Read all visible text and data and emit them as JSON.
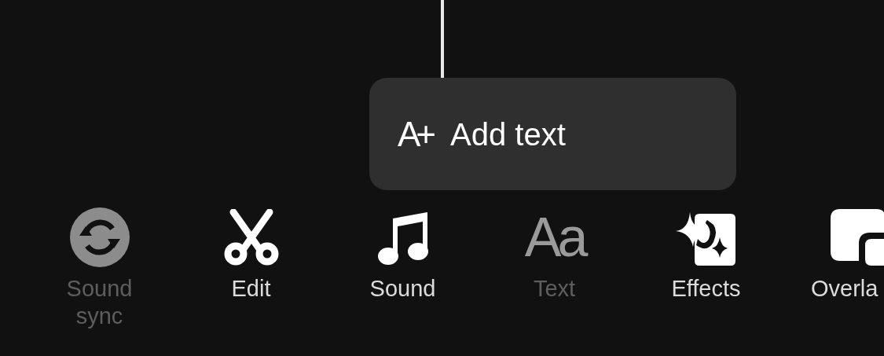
{
  "popup": {
    "glyph": "A+",
    "label": "Add text"
  },
  "toolbar": {
    "items": [
      {
        "kind": "sync",
        "label": "Sound sync",
        "disabled": true
      },
      {
        "kind": "scissors",
        "label": "Edit",
        "disabled": false
      },
      {
        "kind": "music",
        "label": "Sound",
        "disabled": false
      },
      {
        "kind": "glyph",
        "glyph": "Aa",
        "label": "Text",
        "disabled": true
      },
      {
        "kind": "effects",
        "label": "Effects",
        "disabled": false
      },
      {
        "kind": "overlay",
        "label": "Overla",
        "disabled": false
      }
    ]
  }
}
